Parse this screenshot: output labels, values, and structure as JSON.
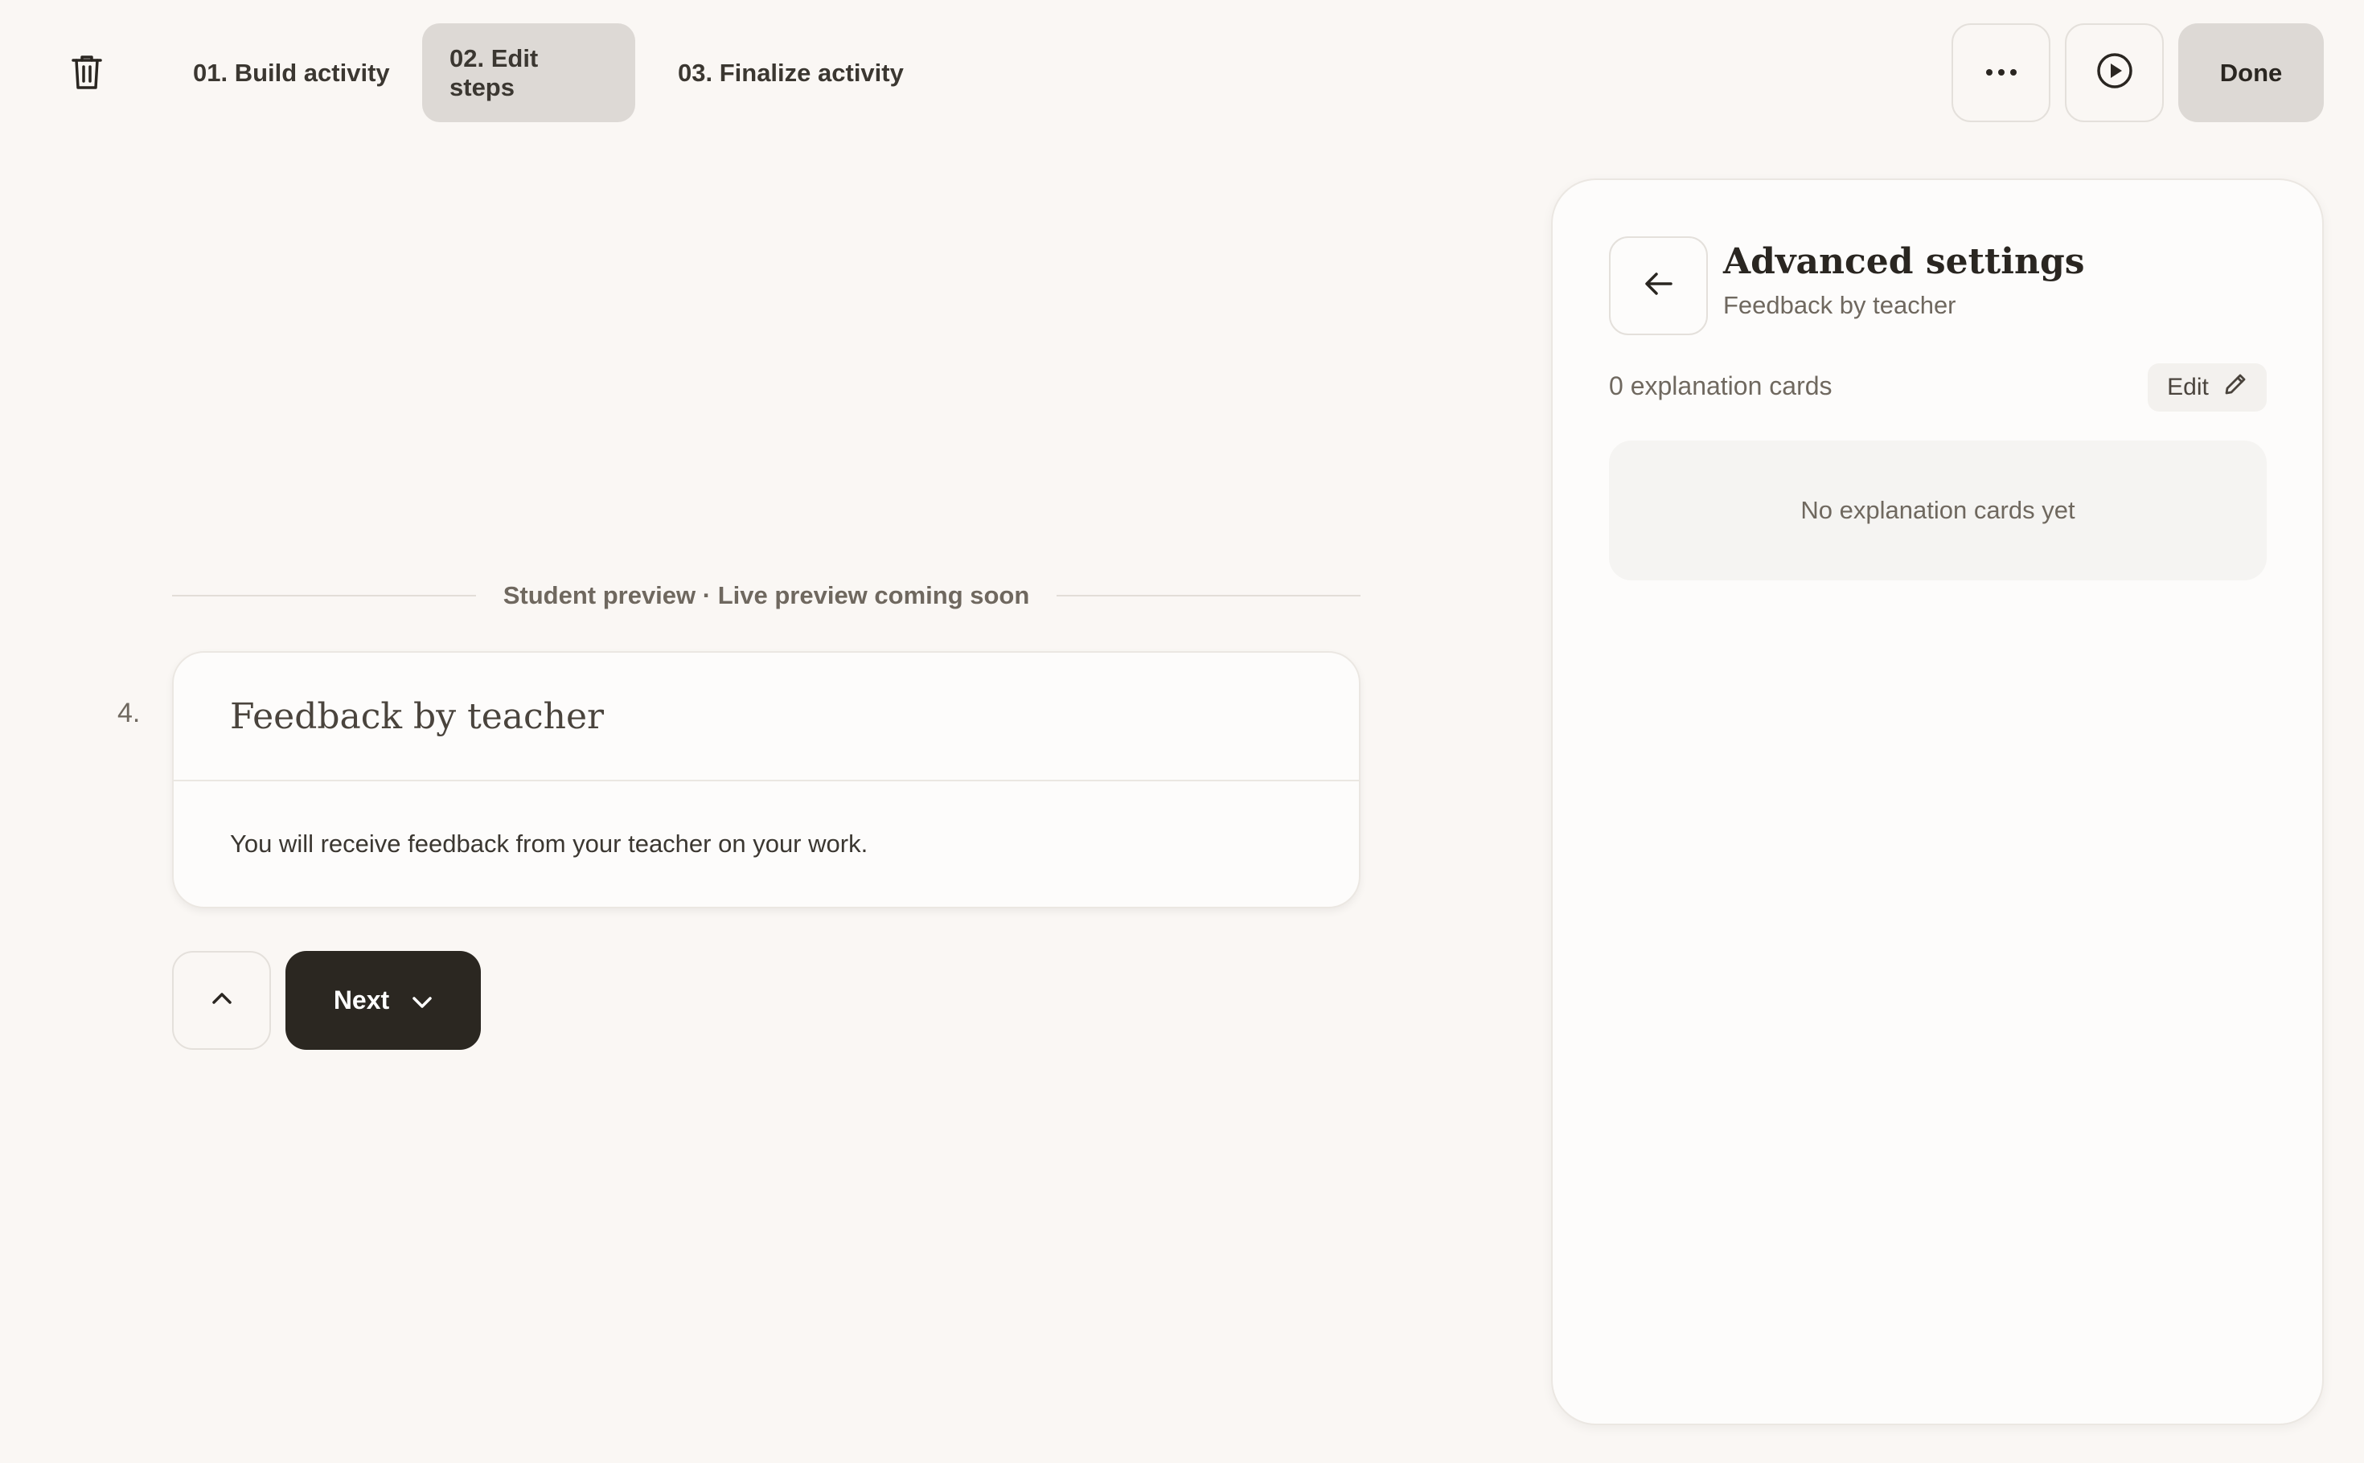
{
  "header": {
    "trash_icon": "trash-icon",
    "steps": [
      {
        "label": "01. Build activity",
        "active": false
      },
      {
        "label": "02. Edit steps",
        "active": true
      },
      {
        "label": "03. Finalize activity",
        "active": false
      }
    ],
    "more_icon": "more-horizontal-icon",
    "play_icon": "play-circle-icon",
    "done_label": "Done"
  },
  "preview": {
    "divider_label": "Student preview · Live preview coming soon",
    "step_number": "4.",
    "card_title": "Feedback by teacher",
    "card_body": "You will receive feedback from your teacher on your work.",
    "up_icon": "chevron-up-icon",
    "next_label": "Next",
    "next_icon": "chevron-down-icon"
  },
  "panel": {
    "back_icon": "arrow-left-icon",
    "title": "Advanced settings",
    "subtitle": "Feedback by teacher",
    "cards_count": "0 explanation cards",
    "edit_label": "Edit",
    "edit_icon": "pencil-icon",
    "empty_message": "No explanation cards yet"
  },
  "colors": {
    "background": "#faf7f4",
    "active_tab": "#ddd9d5",
    "primary_button": "#2b2721",
    "muted_text": "#6f685f"
  }
}
